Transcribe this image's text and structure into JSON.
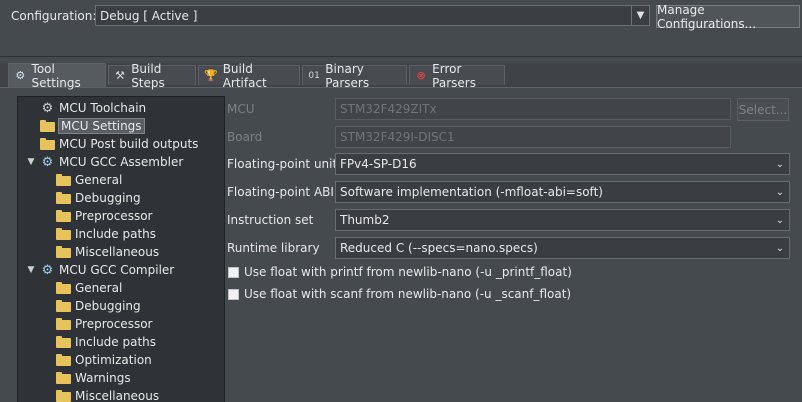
{
  "config": {
    "label": "Configuration:",
    "value": "Debug  [ Active ]",
    "manage_label": "Manage Configurations..."
  },
  "tabs": [
    {
      "label": "Tool Settings",
      "icon": "gear-icon",
      "active": true
    },
    {
      "label": "Build Steps",
      "icon": "hammer-icon",
      "active": false
    },
    {
      "label": "Build Artifact",
      "icon": "trophy-icon",
      "active": false
    },
    {
      "label": "Binary Parsers",
      "icon": "binary-icon",
      "active": false
    },
    {
      "label": "Error Parsers",
      "icon": "error-icon",
      "active": false
    }
  ],
  "tree": [
    {
      "label": "MCU Toolchain",
      "icon": "tool-icon",
      "level": 1
    },
    {
      "label": "MCU Settings",
      "icon": "folder-icon",
      "level": 1,
      "selected": true
    },
    {
      "label": "MCU Post build outputs",
      "icon": "folder-icon",
      "level": 1
    },
    {
      "label": "MCU GCC Assembler",
      "icon": "gear-icon",
      "level": 1,
      "expanded": true
    },
    {
      "label": "General",
      "icon": "folder-icon",
      "level": 2
    },
    {
      "label": "Debugging",
      "icon": "folder-icon",
      "level": 2
    },
    {
      "label": "Preprocessor",
      "icon": "folder-icon",
      "level": 2
    },
    {
      "label": "Include paths",
      "icon": "folder-icon",
      "level": 2
    },
    {
      "label": "Miscellaneous",
      "icon": "folder-icon",
      "level": 2
    },
    {
      "label": "MCU GCC Compiler",
      "icon": "gear-icon",
      "level": 1,
      "expanded": true
    },
    {
      "label": "General",
      "icon": "folder-icon",
      "level": 2
    },
    {
      "label": "Debugging",
      "icon": "folder-icon",
      "level": 2
    },
    {
      "label": "Preprocessor",
      "icon": "folder-icon",
      "level": 2
    },
    {
      "label": "Include paths",
      "icon": "folder-icon",
      "level": 2
    },
    {
      "label": "Optimization",
      "icon": "folder-icon",
      "level": 2
    },
    {
      "label": "Warnings",
      "icon": "folder-icon",
      "level": 2
    },
    {
      "label": "Miscellaneous",
      "icon": "folder-icon",
      "level": 2
    }
  ],
  "form": {
    "mcu": {
      "label": "MCU",
      "value": "STM32F429ZITx",
      "select_label": "Select..."
    },
    "board": {
      "label": "Board",
      "value": "STM32F429I-DISC1"
    },
    "fpu": {
      "label": "Floating-point unit",
      "value": "FPv4-SP-D16"
    },
    "fabi": {
      "label": "Floating-point ABI",
      "value": "Software implementation (-mfloat-abi=soft)"
    },
    "iset": {
      "label": "Instruction set",
      "value": "Thumb2"
    },
    "rtlib": {
      "label": "Runtime library",
      "value": "Reduced C (--specs=nano.specs)"
    },
    "printf_float": {
      "label": "Use float with printf from newlib-nano (-u _printf_float)",
      "checked": false
    },
    "scanf_float": {
      "label": "Use float with scanf from newlib-nano (-u _scanf_float)",
      "checked": false
    }
  }
}
